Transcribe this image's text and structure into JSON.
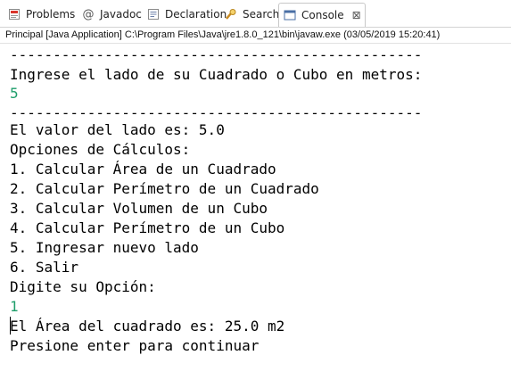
{
  "tabs": [
    {
      "label": "Problems",
      "icon": "problems-icon"
    },
    {
      "label": "Javadoc",
      "icon": "at-icon"
    },
    {
      "label": "Declaration",
      "icon": "declaration-icon"
    },
    {
      "label": "Search",
      "icon": "search-icon"
    },
    {
      "label": "Console",
      "icon": "console-icon",
      "active": true
    }
  ],
  "close_symbol": "⊠",
  "launch_info": "Principal [Java Application] C:\\Program Files\\Java\\jre1.8.0_121\\bin\\javaw.exe (03/05/2019 15:20:41)",
  "console_lines": [
    {
      "text": "------------------------------------------------",
      "input": false
    },
    {
      "text": "Ingrese el lado de su Cuadrado o Cubo en metros:",
      "input": false
    },
    {
      "text": "5",
      "input": true
    },
    {
      "text": "------------------------------------------------",
      "input": false
    },
    {
      "text": "El valor del lado es: 5.0",
      "input": false
    },
    {
      "text": "Opciones de Cálculos:",
      "input": false
    },
    {
      "text": "1. Calcular Área de un Cuadrado",
      "input": false
    },
    {
      "text": "2. Calcular Perímetro de un Cuadrado",
      "input": false
    },
    {
      "text": "3. Calcular Volumen de un Cubo",
      "input": false
    },
    {
      "text": "4. Calcular Perímetro de un Cubo",
      "input": false
    },
    {
      "text": "5. Ingresar nuevo lado",
      "input": false
    },
    {
      "text": "6. Salir",
      "input": false
    },
    {
      "text": "Digite su Opción:",
      "input": false
    },
    {
      "text": "1",
      "input": true
    },
    {
      "text": "El Área del cuadrado es: 25.0 m2",
      "input": false
    },
    {
      "text": "Presione enter para continuar",
      "input": false
    }
  ],
  "colors": {
    "input_text": "#1f9e6b"
  }
}
